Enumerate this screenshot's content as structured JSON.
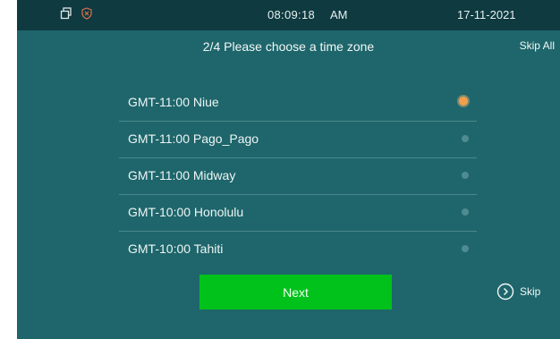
{
  "status_bar": {
    "icons": [
      "window-restore-icon",
      "shield-icon"
    ],
    "time": "08:09:18",
    "ampm": "AM",
    "date": "17-11-2021"
  },
  "header": {
    "title": "2/4 Please choose a time zone",
    "skip_all_label": "Skip All"
  },
  "timezones": [
    {
      "label": "GMT-11:00 Niue",
      "selected": true
    },
    {
      "label": "GMT-11:00 Pago_Pago",
      "selected": false
    },
    {
      "label": "GMT-11:00 Midway",
      "selected": false
    },
    {
      "label": "GMT-10:00 Honolulu",
      "selected": false
    },
    {
      "label": "GMT-10:00 Tahiti",
      "selected": false
    }
  ],
  "footer": {
    "next_label": "Next",
    "skip_label": "Skip",
    "skip_icon": "chevron-circle-right-icon"
  },
  "colors": {
    "background": "#1e666b",
    "status_bar": "#0e3a40",
    "next_button": "#00c21a",
    "selected_radio": "#f0a04b"
  }
}
